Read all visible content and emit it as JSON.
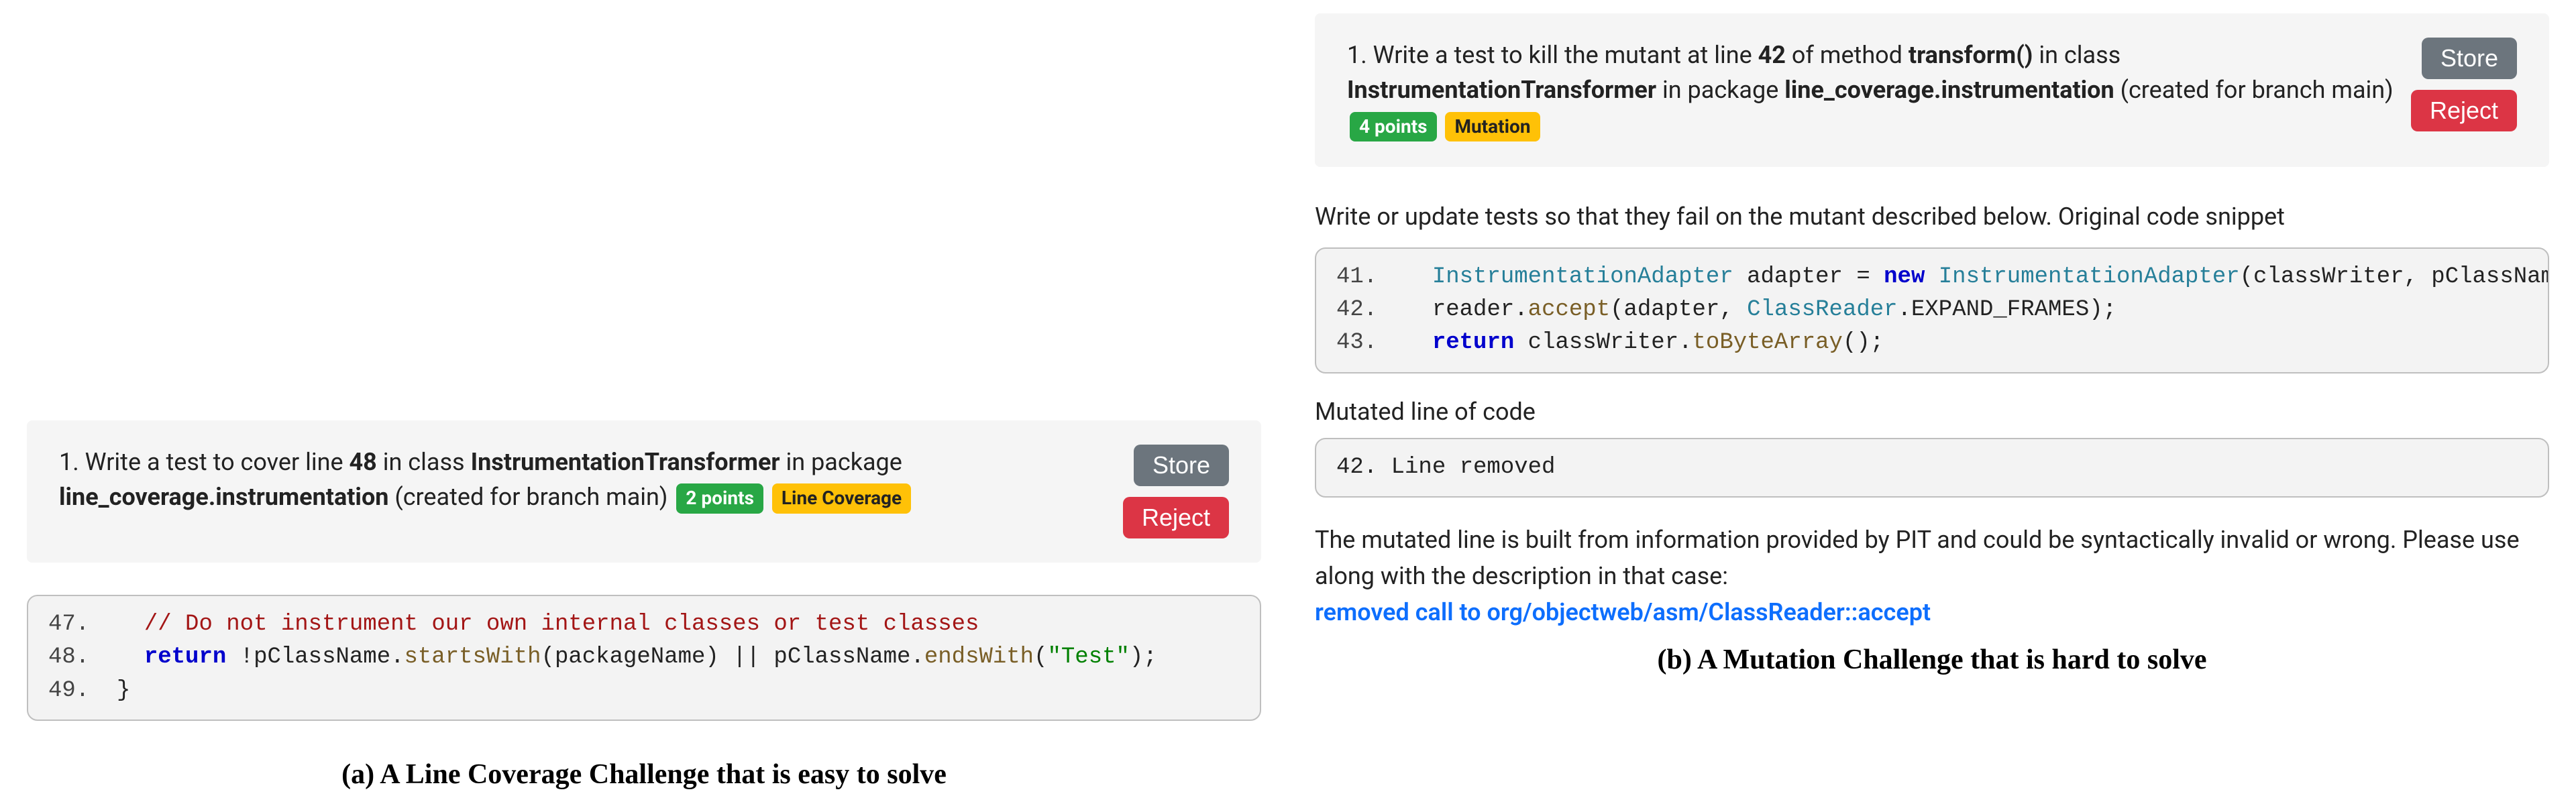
{
  "left": {
    "challenge": {
      "prefix": "1. Write a test to cover line ",
      "line_num": "48",
      "mid1": " in class ",
      "class_name": "InstrumentationTransformer",
      "mid2": " in package ",
      "package_name": "line_coverage.instrumentation",
      "suffix": " (created for branch main)",
      "points": "2 points",
      "type_badge": "Line Coverage"
    },
    "store_btn": "Store",
    "reject_btn": "Reject",
    "code": {
      "l47_num": "47.",
      "l47_cmt": "// Do not instrument our own internal classes or test classes",
      "l48_num": "48.",
      "l48_kw": "return",
      "l48_a": " !pClassName.",
      "l48_m1": "startsWith",
      "l48_b": "(packageName) || pClassName.",
      "l48_m2": "endsWith",
      "l48_c": "(",
      "l48_str": "\"Test\"",
      "l48_d": ");",
      "l49_num": "49.",
      "l49_brace": "}"
    },
    "caption": "(a) A Line Coverage Challenge that is easy to solve"
  },
  "right": {
    "challenge": {
      "prefix": "1. Write a test to kill the mutant at line ",
      "line_num": "42",
      "mid1": " of method ",
      "method_name": "transform()",
      "mid2": " in class ",
      "class_name": "InstrumentationTransformer",
      "mid3": " in package ",
      "package_name": "line_coverage.instrumentation",
      "suffix": " (created for branch main)",
      "points": "4 points",
      "type_badge": "Mutation"
    },
    "store_btn": "Store",
    "reject_btn": "Reject",
    "instruction": "Write or update tests so that they fail on the mutant described below. Original code snippet",
    "code": {
      "l41_num": "41.",
      "l41_type1": "InstrumentationAdapter",
      "l41_a": " adapter = ",
      "l41_kw": "new",
      "l41_b": " ",
      "l41_type2": "InstrumentationAdapter",
      "l41_c": "(classWriter, pClassName);",
      "l42_num": "42.",
      "l42_a": "reader.",
      "l42_m1": "accept",
      "l42_b": "(adapter, ",
      "l42_type": "ClassReader",
      "l42_c": ".EXPAND_FRAMES);",
      "l43_num": "43.",
      "l43_kw": "return",
      "l43_a": " classWriter.",
      "l43_m1": "toByteArray",
      "l43_b": "();"
    },
    "mutated_label": "Mutated line of code",
    "mutated_code": "42. Line removed",
    "mutation_desc": "The mutated line is built from information provided by PIT and could be syntactically invalid or wrong. Please use along with the description in that case:",
    "mutation_link": "removed call to org/objectweb/asm/ClassReader::accept",
    "caption": "(b) A Mutation Challenge that is hard to solve"
  }
}
